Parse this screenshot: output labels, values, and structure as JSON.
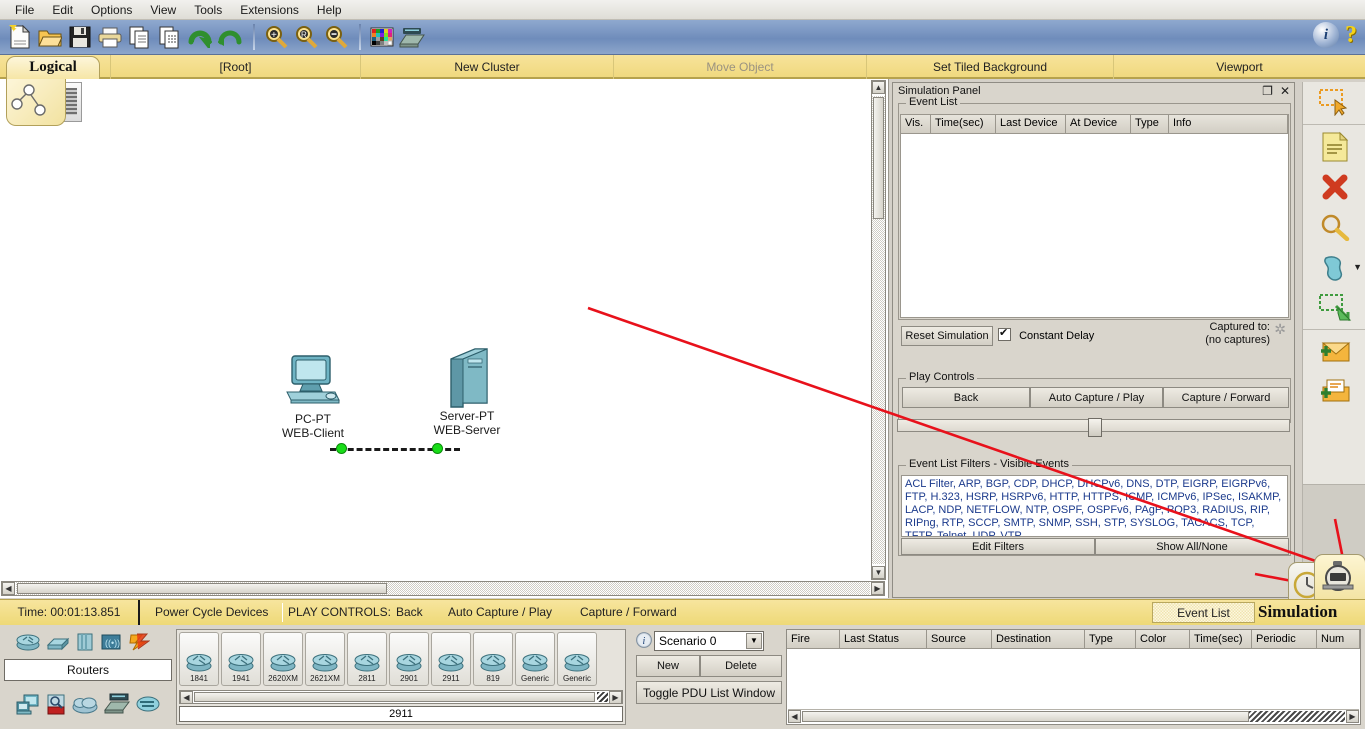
{
  "menu": {
    "items": [
      "File",
      "Edit",
      "Options",
      "View",
      "Tools",
      "Extensions",
      "Help"
    ]
  },
  "toolbar": {
    "icons": [
      "new-file-icon",
      "open-folder-icon",
      "save-icon",
      "print-icon",
      "copy-icon",
      "paste-icon",
      "undo-icon",
      "redo-icon",
      "zoom-in-icon",
      "zoom-reset-icon",
      "zoom-out-icon",
      "palette-icon",
      "custom-devices-icon"
    ],
    "info_label": "i",
    "help_label": "?"
  },
  "topbar": {
    "logical_tab": "Logical",
    "cells": [
      "[Root]",
      "New Cluster",
      "Move Object",
      "Set Tiled Background",
      "Viewport"
    ]
  },
  "canvas": {
    "devices": [
      {
        "model": "PC-PT",
        "name": "WEB-Client",
        "icon": "pc-icon"
      },
      {
        "model": "Server-PT",
        "name": "WEB-Server",
        "icon": "server-icon"
      }
    ]
  },
  "simulation_panel": {
    "title": "Simulation Panel",
    "restore_icon": "restore-window-icon",
    "close_icon": "close-icon",
    "event_list": {
      "legend": "Event List",
      "columns": [
        "Vis.",
        "Time(sec)",
        "Last Device",
        "At Device",
        "Type",
        "Info"
      ],
      "rows": []
    },
    "reset_button": "Reset Simulation",
    "constant_delay_label": "Constant Delay",
    "constant_delay_checked": true,
    "captured_to_line1": "Captured to:",
    "captured_to_line2": "(no captures)",
    "play_controls": {
      "legend": "Play Controls",
      "back": "Back",
      "auto_capture_play": "Auto Capture / Play",
      "capture_forward": "Capture / Forward"
    },
    "filters": {
      "legend": "Event List Filters - Visible Events",
      "text": "ACL Filter, ARP, BGP, CDP, DHCP, DHCPv6, DNS, DTP, EIGRP, EIGRPv6, FTP, H.323, HSRP, HSRPv6, HTTP, HTTPS, ICMP, ICMPv6, IPSec, ISAKMP, LACP, NDP, NETFLOW, NTP, OSPF, OSPFv6, PAgP, POP3, RADIUS, RIP, RIPng, RTP, SCCP, SMTP, SNMP, SSH, STP, SYSLOG, TACACS, TCP, TFTP, Telnet, UDP, VTP",
      "edit_filters": "Edit Filters",
      "show_all_none": "Show All/None"
    }
  },
  "right_toolbar": {
    "items": [
      {
        "name": "select-tool-icon"
      },
      {
        "name": "inspect-note-icon"
      },
      {
        "name": "delete-icon"
      },
      {
        "name": "inspect-magnifier-icon"
      },
      {
        "name": "resize-shape-icon"
      },
      {
        "name": "place-note-icon"
      },
      {
        "name": "add-simple-pdu-icon"
      },
      {
        "name": "add-complex-pdu-icon"
      }
    ]
  },
  "mode_tabs": {
    "realtime": "realtime-clock-icon",
    "simulation": "simulation-stopwatch-icon",
    "active": "simulation"
  },
  "status_bar": {
    "time": "Time: 00:01:13.851",
    "power_cycle": "Power Cycle Devices",
    "play_controls_label": "PLAY CONTROLS:",
    "back": "Back",
    "auto_capture_play": "Auto Capture / Play",
    "capture_forward": "Capture / Forward",
    "event_list_button": "Event List",
    "mode_label": "Simulation"
  },
  "device_palette": {
    "category": "Routers",
    "type_icons_row1": [
      "router-type-icon",
      "switch-type-icon",
      "hub-type-icon",
      "wireless-type-icon",
      "connections-type-icon"
    ],
    "type_icons_row2": [
      "end-devices-type-icon",
      "security-type-icon",
      "wan-cloud-type-icon",
      "multiuser-type-icon",
      "custom-type-icon"
    ],
    "devices": [
      "1841",
      "1941",
      "2620XM",
      "2621XM",
      "2811",
      "2901",
      "2911",
      "819",
      "Generic",
      "Generic"
    ],
    "selected_device": "2911"
  },
  "scenario": {
    "info_icon": "info-icon",
    "selected": "Scenario 0",
    "new_button": "New",
    "delete_button": "Delete",
    "toggle_pdu_button": "Toggle PDU List Window"
  },
  "pdu_list": {
    "columns": [
      "Fire",
      "Last Status",
      "Source",
      "Destination",
      "Type",
      "Color",
      "Time(sec)",
      "Periodic",
      "Num"
    ],
    "rows": []
  },
  "colors": {
    "yellow_bar": "#f0d97f",
    "toolbar_blue": "#6f8cbb",
    "panel_gray": "#d9d5cc",
    "link_active": "#19dd19",
    "annotation_red": "#e8111b",
    "filter_text": "#1b3a8c"
  }
}
